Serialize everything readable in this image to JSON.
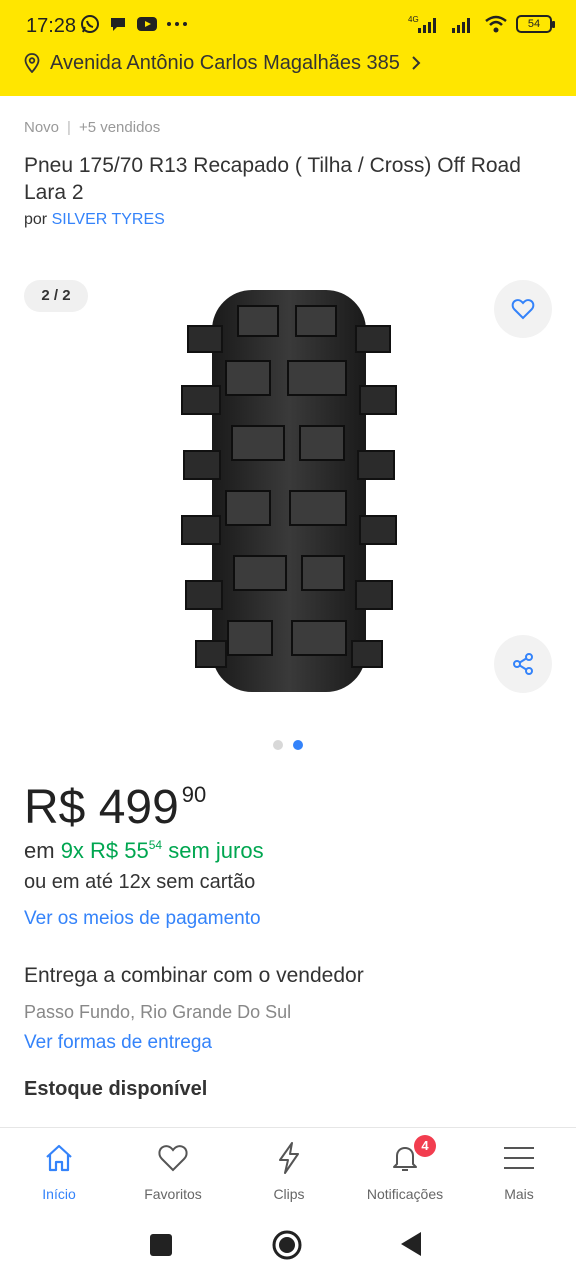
{
  "status_bar": {
    "time": "17:28",
    "network": "4G",
    "battery": "54"
  },
  "header": {
    "address": "Avenida Antônio Carlos Magalhães 385",
    "accent_color": "#ffe600"
  },
  "product": {
    "condition": "Novo",
    "sold": "+5 vendidos",
    "title": "Pneu 175/70 R13 Recapado ( Tilha / Cross) Off Road Lara 2",
    "seller_prefix": "por",
    "seller_name": "SILVER TYRES"
  },
  "gallery": {
    "counter": "2 / 2",
    "current_index": 2,
    "total": 2
  },
  "price": {
    "currency_amount": "R$ 499",
    "cents": "90",
    "installment_prefix": "em",
    "installment_amount": "9x R$ 55",
    "installment_cents": "54",
    "installment_suffix": "sem juros",
    "alt_installment": "ou em até 12x sem cartão",
    "payment_link": "Ver os meios de pagamento"
  },
  "delivery": {
    "text": "Entrega a combinar com o vendedor",
    "location": "Passo Fundo, Rio Grande Do Sul",
    "link": "Ver formas de entrega"
  },
  "stock": {
    "label": "Estoque disponível"
  },
  "bottom_nav": {
    "items": [
      {
        "label": "Início",
        "icon": "home-icon",
        "active": true
      },
      {
        "label": "Favoritos",
        "icon": "heart-icon"
      },
      {
        "label": "Clips",
        "icon": "lightning-icon"
      },
      {
        "label": "Notificações",
        "icon": "bell-icon",
        "badge": "4"
      },
      {
        "label": "Mais",
        "icon": "menu-icon"
      }
    ]
  },
  "colors": {
    "link": "#3483fa",
    "green": "#00a650",
    "badge": "#f23d4f"
  }
}
